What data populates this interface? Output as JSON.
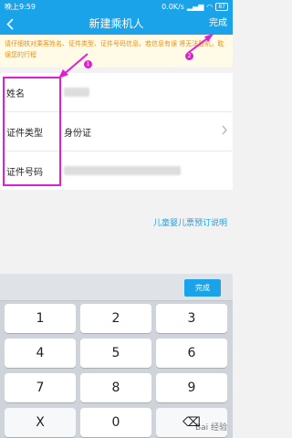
{
  "status": {
    "time": "晚上9:59",
    "speed": "0.0K/s",
    "battery": "87"
  },
  "header": {
    "title": "新建乘机人",
    "done_label": "完成"
  },
  "notice": {
    "text": "请仔细核对乘客姓名、证件类型、证件号码信息。若信息有误 将无法登机，耽误您的行程"
  },
  "form": {
    "name_label": "姓名",
    "id_type_label": "证件类型",
    "id_type_value": "身份证",
    "id_number_label": "证件号码"
  },
  "child_ticket_link": "儿童婴儿票预订说明",
  "annotations": {
    "badge_1": "1",
    "badge_2": "2"
  },
  "keyboard": {
    "done_label": "完成",
    "keys": [
      "1",
      "2",
      "3",
      "4",
      "5",
      "6",
      "7",
      "8",
      "9",
      "X",
      "0",
      "⌫"
    ]
  },
  "watermark": "Bai 经验",
  "colors": {
    "primary": "#1aa3e8",
    "notice_text": "#f08c1a",
    "annotation": "#e020d0"
  }
}
